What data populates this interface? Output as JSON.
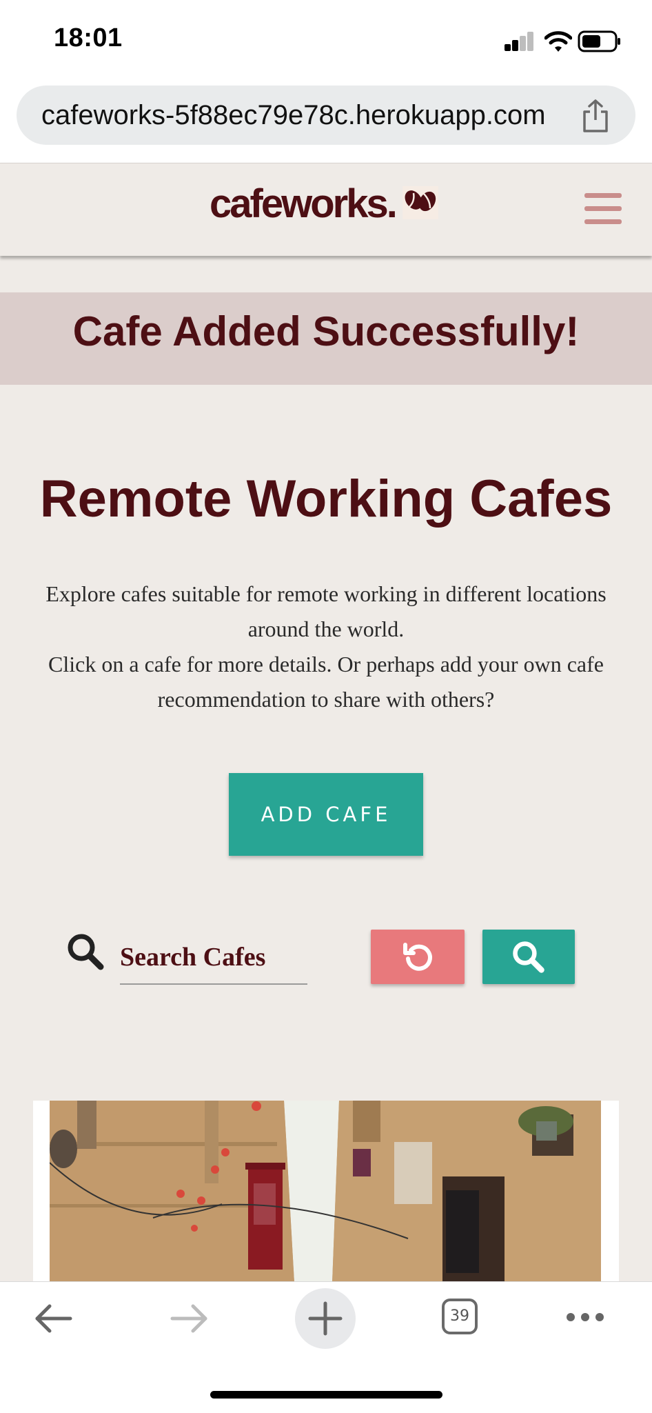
{
  "status_bar": {
    "time": "18:01"
  },
  "browser": {
    "url": "cafeworks-5f88ec79e78c.herokuapp.com",
    "tab_count": "39"
  },
  "header": {
    "logo_text": "cafeworks."
  },
  "banner": {
    "message": "Cafe Added Successfully!"
  },
  "main": {
    "title": "Remote Working Cafes",
    "intro_line1": "Explore cafes suitable for remote working in different locations around the world.",
    "intro_line2": "Click on a cafe for more details. Or perhaps add your own cafe recommendation to share with others?",
    "add_cafe_label": "ADD CAFE"
  },
  "search": {
    "placeholder": "Search Cafes"
  },
  "colors": {
    "brand_dark": "#4d0f14",
    "teal": "#28a594",
    "coral": "#e8797c",
    "page_bg": "#efebe7",
    "banner_bg": "#dbcdcb"
  },
  "icons": [
    "signal-icon",
    "wifi-icon",
    "battery-icon",
    "share-icon",
    "coffee-bean-icon",
    "hamburger-menu-icon",
    "search-icon",
    "reset-icon",
    "back-arrow-icon",
    "forward-arrow-icon",
    "new-tab-icon",
    "tabs-icon",
    "more-icon"
  ]
}
